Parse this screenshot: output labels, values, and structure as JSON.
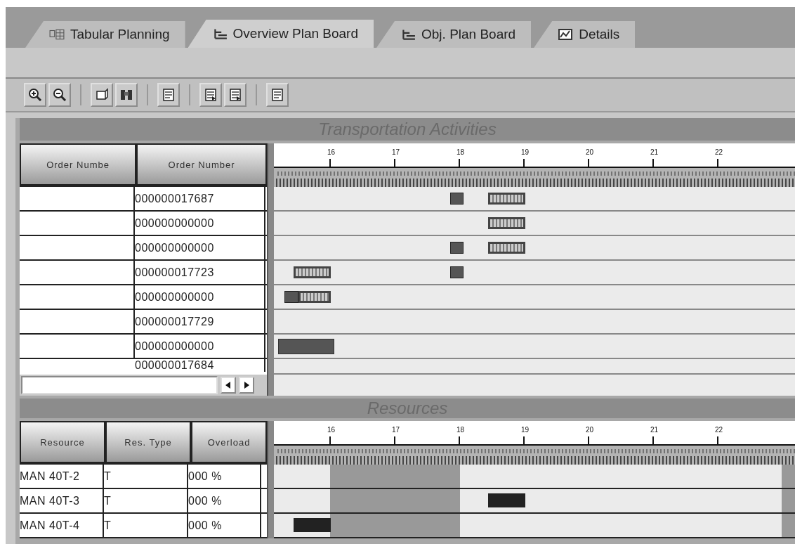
{
  "tabs": [
    {
      "label": "Tabular Planning",
      "selected": false
    },
    {
      "label": "Overview Plan Board",
      "selected": true
    },
    {
      "label": "Obj. Plan Board",
      "selected": false
    },
    {
      "label": "Details",
      "selected": false
    }
  ],
  "transport": {
    "title": "Transportation Activities",
    "columns": [
      "Order Numbe",
      "Order Number"
    ],
    "hours": [
      "16",
      "17",
      "18",
      "19",
      "20",
      "21",
      "22"
    ],
    "rows": [
      {
        "order_number": "000000017687"
      },
      {
        "order_number": "000000000000"
      },
      {
        "order_number": "000000000000"
      },
      {
        "order_number": "000000017723"
      },
      {
        "order_number": "000000000000"
      },
      {
        "order_number": "000000017729"
      },
      {
        "order_number": "000000000000"
      },
      {
        "order_number": "000000017684"
      }
    ]
  },
  "resources": {
    "title": "Resources",
    "columns": [
      "Resource",
      "Res. Type",
      "Overload"
    ],
    "hours": [
      "16",
      "17",
      "18",
      "19",
      "20",
      "21",
      "22"
    ],
    "rows": [
      {
        "resource": "MAN 40T-2",
        "res_type": "T",
        "overload": "000 %"
      },
      {
        "resource": "MAN 40T-3",
        "res_type": "T",
        "overload": "000 %"
      },
      {
        "resource": "MAN 40T-4",
        "res_type": "T",
        "overload": "000 %"
      }
    ]
  }
}
